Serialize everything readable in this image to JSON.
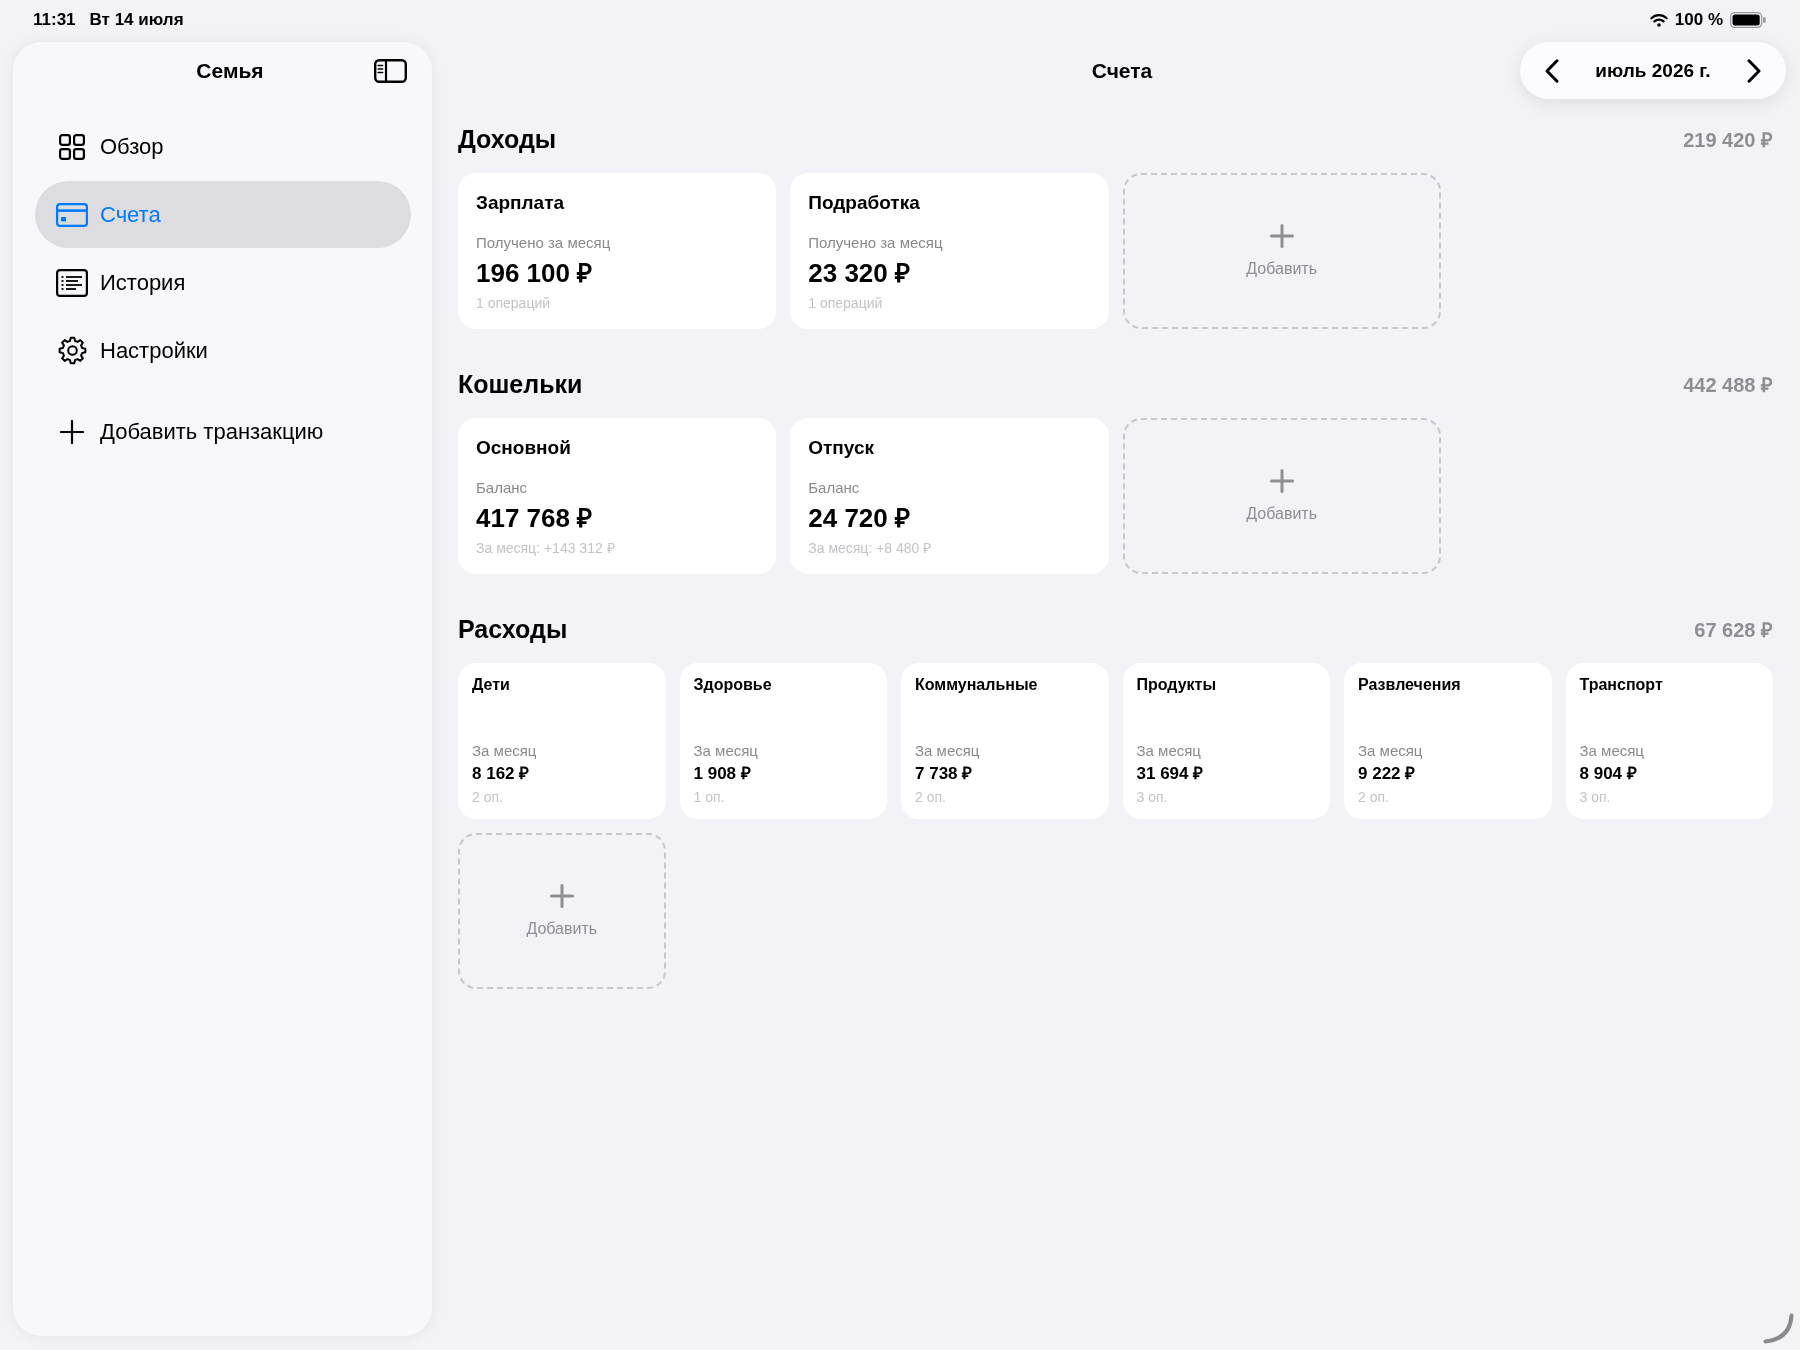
{
  "status_bar": {
    "time": "11:31",
    "date": "Вт 14 июля",
    "battery": "100 %"
  },
  "sidebar": {
    "title": "Семья",
    "items": [
      {
        "label": "Обзор",
        "selected": false
      },
      {
        "label": "Счета",
        "selected": true
      },
      {
        "label": "История",
        "selected": false
      },
      {
        "label": "Настройки",
        "selected": false
      }
    ],
    "add_action": "Добавить транзакцию"
  },
  "header": {
    "title": "Счета",
    "month": "июль 2026 г."
  },
  "sections": [
    {
      "title": "Доходы",
      "total": "219 420 ₽",
      "kind": "large",
      "cards": [
        {
          "name": "Зарплата",
          "caption": "Получено за месяц",
          "amount": "196 100 ₽",
          "note": "1 операций"
        },
        {
          "name": "Подработка",
          "caption": "Получено за месяц",
          "amount": "23 320 ₽",
          "note": "1 операций"
        }
      ],
      "add_label": "Добавить"
    },
    {
      "title": "Кошельки",
      "total": "442 488 ₽",
      "kind": "large",
      "cards": [
        {
          "name": "Основной",
          "caption": "Баланс",
          "amount": "417 768 ₽",
          "note": "За месяц: +143 312 ₽"
        },
        {
          "name": "Отпуск",
          "caption": "Баланс",
          "amount": "24 720 ₽",
          "note": "За месяц: +8 480 ₽"
        }
      ],
      "add_label": "Добавить"
    },
    {
      "title": "Расходы",
      "total": "67 628 ₽",
      "kind": "small",
      "cards": [
        {
          "name": "Дети",
          "caption": "За месяц",
          "amount": "8 162 ₽",
          "note": "2 оп."
        },
        {
          "name": "Здоровье",
          "caption": "За месяц",
          "amount": "1 908 ₽",
          "note": "1 оп."
        },
        {
          "name": "Коммунальные",
          "caption": "За месяц",
          "amount": "7 738 ₽",
          "note": "2 оп."
        },
        {
          "name": "Продукты",
          "caption": "За месяц",
          "amount": "31 694 ₽",
          "note": "3 оп."
        },
        {
          "name": "Развлечения",
          "caption": "За месяц",
          "amount": "9 222 ₽",
          "note": "2 оп."
        },
        {
          "name": "Транспорт",
          "caption": "За месяц",
          "amount": "8 904 ₽",
          "note": "3 оп."
        }
      ],
      "add_label": "Добавить"
    }
  ]
}
